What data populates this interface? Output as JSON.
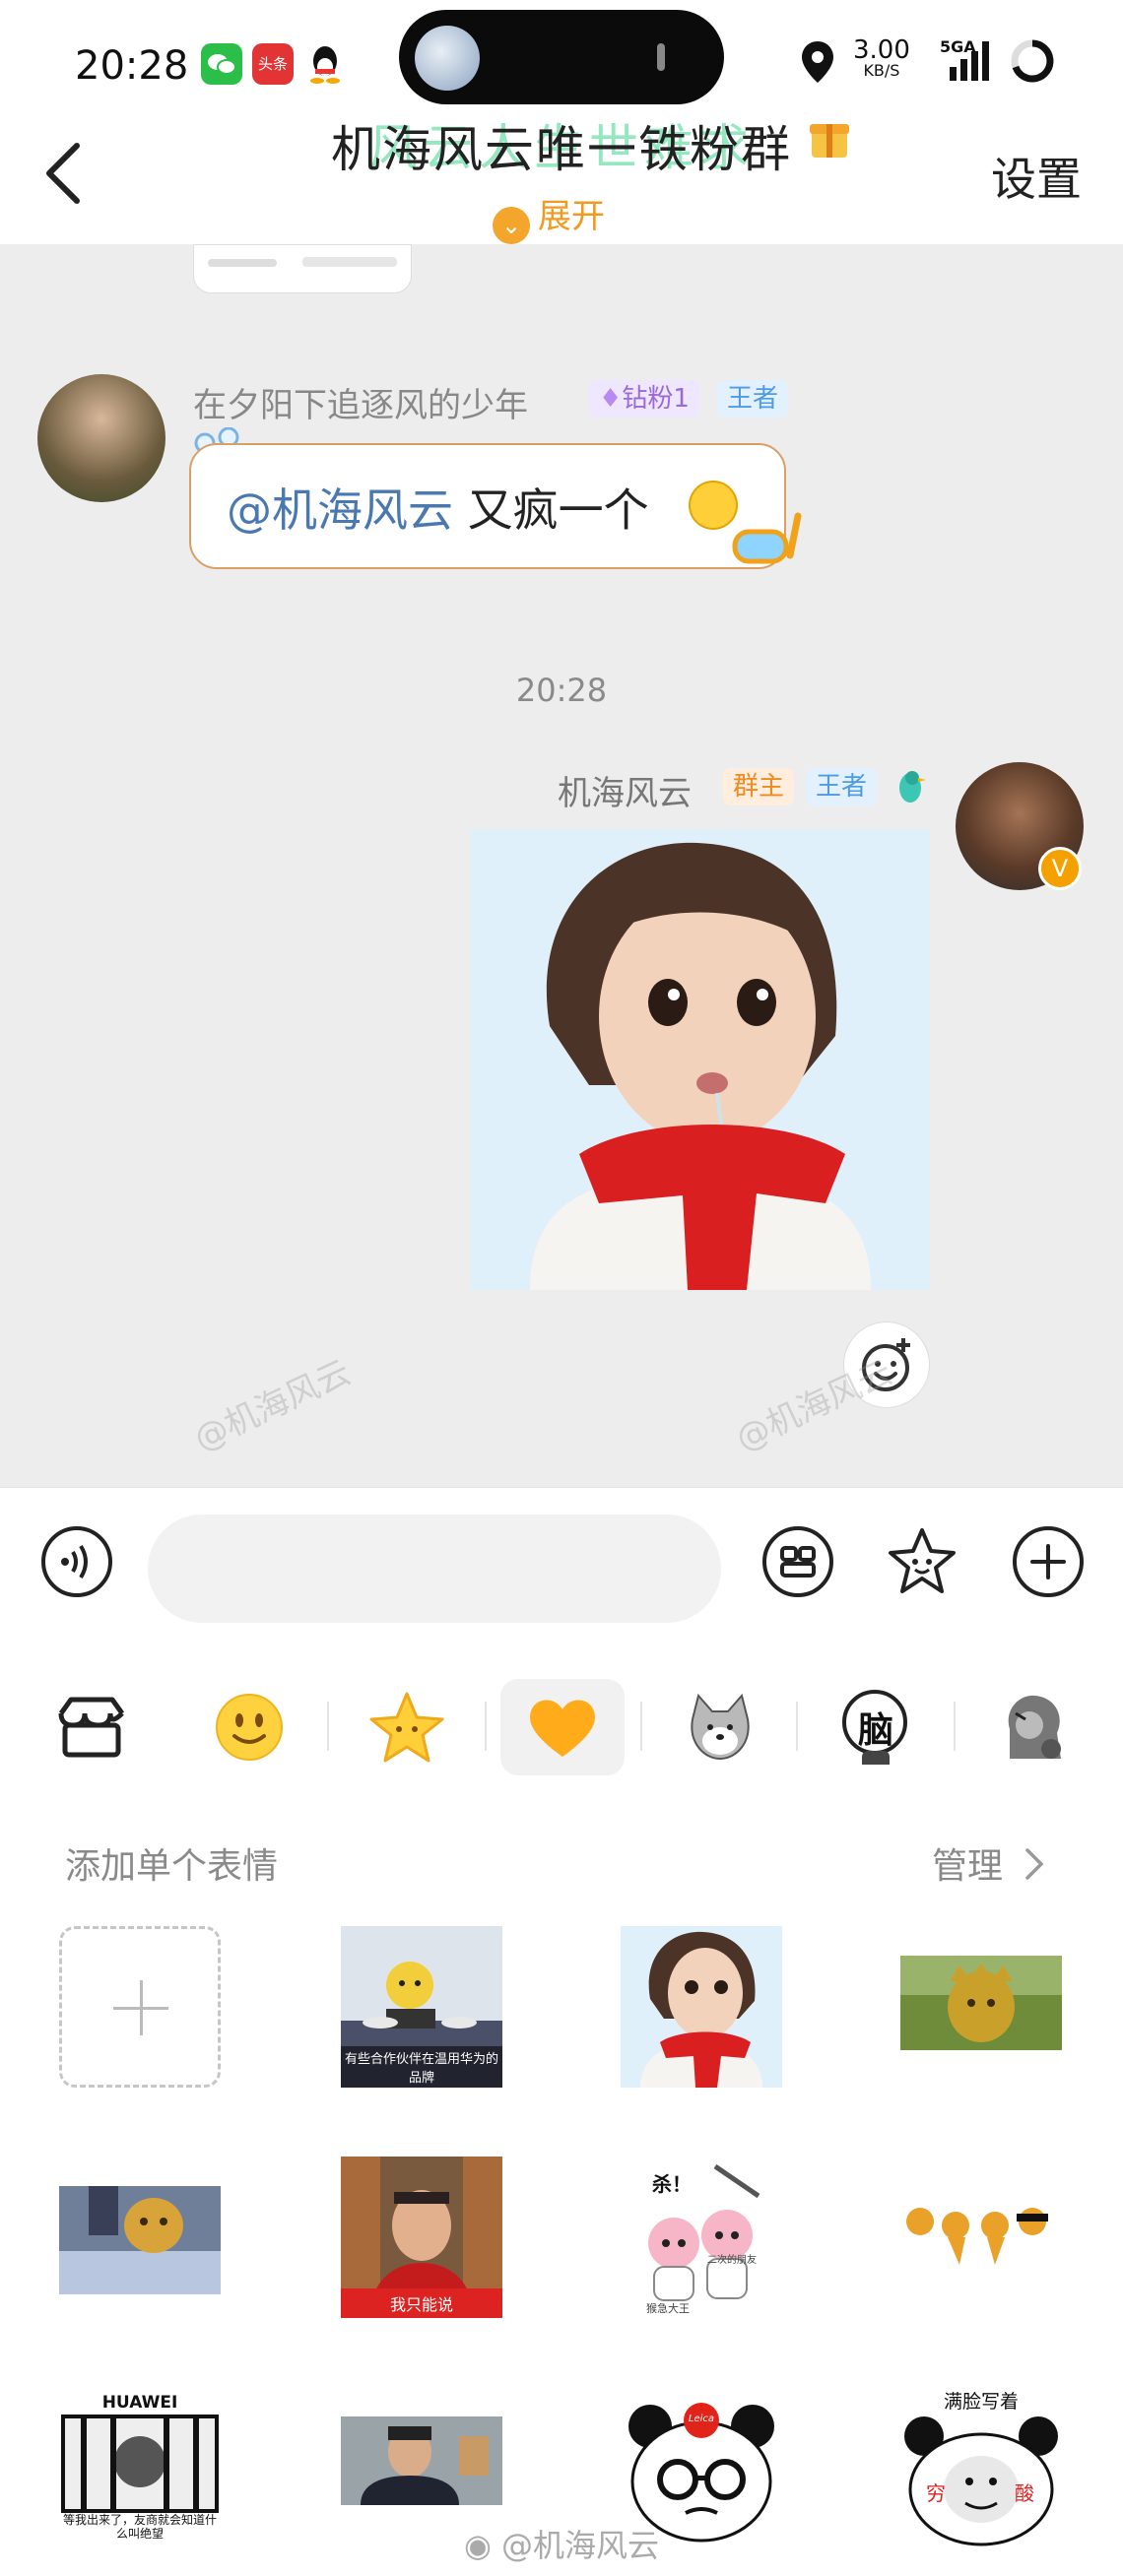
{
  "status_bar": {
    "time": "20:28",
    "notif_toutiao": "头条",
    "net_speed": "3.00",
    "net_unit": "KB/S",
    "signal_label": "5GA"
  },
  "header": {
    "title": "机海风云唯一铁粉群",
    "title_overlay": "风云人生世难求",
    "expand_label": "展开",
    "settings_label": "设置"
  },
  "messages": {
    "left": {
      "sender": "在夕阳下追逐风的少年",
      "badge_fan": "钻粉1",
      "badge_level": "王者",
      "mention": "@机海风云",
      "text": " 又疯一个"
    },
    "timestamp": "20:28",
    "right": {
      "sender": "机海风云",
      "badge_owner": "群主",
      "badge_level": "王者"
    }
  },
  "panel": {
    "section_title": "添加单个表情",
    "manage_label": "管理",
    "tabs": [
      "store-icon",
      "smiley-icon",
      "star-icon",
      "heart-icon",
      "shiba-icon",
      "brain-icon",
      "character-icon"
    ],
    "tab_brain_text": "脑",
    "stickers": {
      "s1_caption": "有些合作伙伴在温用华为的品牌",
      "s6_caption": "我只能说",
      "s7_top": "杀！",
      "s7_left": "猴急大王",
      "s7_right": "二次的朋友",
      "s9_title": "HUAWEI",
      "s9_caption": "等我出来了，友商就会知道什么叫绝望",
      "s11_brand": "Leica",
      "s12_title": "满脸写着",
      "s12_left": "穷",
      "s12_right": "酸"
    }
  },
  "watermark": "@机海风云",
  "colors": {
    "chat_bg": "#ededed",
    "accent_orange": "#f3a52c",
    "mention_blue": "#4a78b0",
    "badge_purple_bg": "#efe6ff",
    "badge_blue_bg": "#e3f1ff",
    "badge_orange_bg": "#ffeede"
  }
}
